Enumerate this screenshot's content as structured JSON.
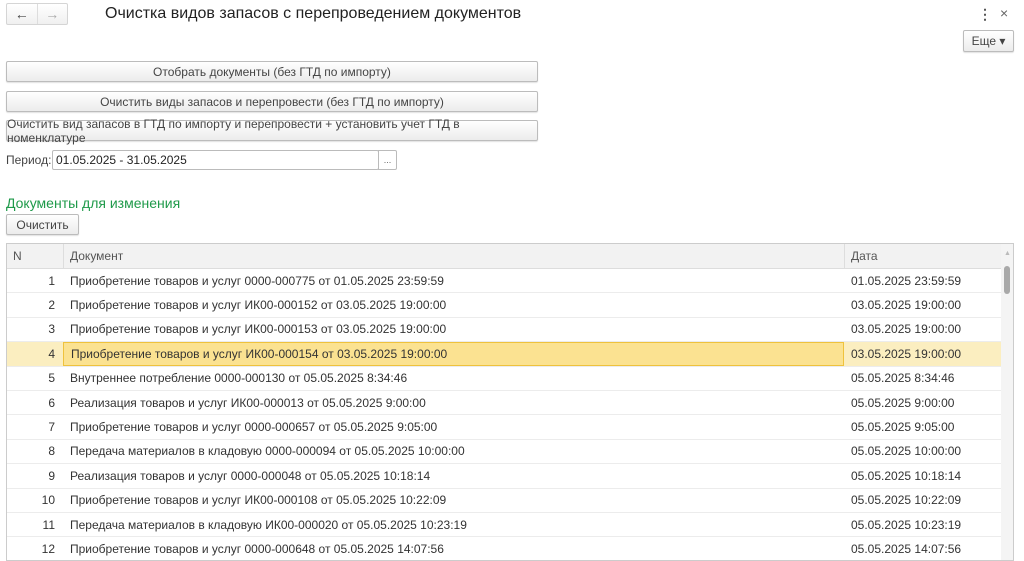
{
  "header": {
    "title": "Очистка видов запасов с перепроведением документов",
    "back": "←",
    "forward": "→",
    "menu": "⋮",
    "close": "×",
    "more_label": "Еще ▾"
  },
  "actions": {
    "select_docs": "Отобрать документы (без ГТД по импорту)",
    "clear_repost": "Очистить виды запасов и перепровести (без ГТД по импорту)",
    "clear_gtd": "Очистить вид запасов в ГТД по импорту и перепровести + установить учет ГТД в номенклатуре"
  },
  "period": {
    "label": "Период:",
    "value": "01.05.2025 - 31.05.2025",
    "select": "..."
  },
  "section": {
    "title": "Документы для изменения",
    "clear_label": "Очистить"
  },
  "table": {
    "columns": [
      "N",
      "Документ",
      "Дата"
    ],
    "selected_row": 4,
    "rows": [
      {
        "n": "1",
        "doc": "Приобретение товаров и услуг 0000-000775 от 01.05.2025 23:59:59",
        "date": "01.05.2025 23:59:59"
      },
      {
        "n": "2",
        "doc": "Приобретение товаров и услуг ИК00-000152 от 03.05.2025 19:00:00",
        "date": "03.05.2025 19:00:00"
      },
      {
        "n": "3",
        "doc": "Приобретение товаров и услуг ИК00-000153 от 03.05.2025 19:00:00",
        "date": "03.05.2025 19:00:00"
      },
      {
        "n": "4",
        "doc": "Приобретение товаров и услуг ИК00-000154 от 03.05.2025 19:00:00",
        "date": "03.05.2025 19:00:00"
      },
      {
        "n": "5",
        "doc": "Внутреннее потребление 0000-000130 от 05.05.2025 8:34:46",
        "date": "05.05.2025 8:34:46"
      },
      {
        "n": "6",
        "doc": "Реализация товаров и услуг ИК00-000013 от 05.05.2025 9:00:00",
        "date": "05.05.2025 9:00:00"
      },
      {
        "n": "7",
        "doc": "Приобретение товаров и услуг 0000-000657 от 05.05.2025 9:05:00",
        "date": "05.05.2025 9:05:00"
      },
      {
        "n": "8",
        "doc": "Передача материалов в кладовую 0000-000094 от 05.05.2025 10:00:00",
        "date": "05.05.2025 10:00:00"
      },
      {
        "n": "9",
        "doc": "Реализация товаров и услуг 0000-000048 от 05.05.2025 10:18:14",
        "date": "05.05.2025 10:18:14"
      },
      {
        "n": "10",
        "doc": "Приобретение товаров и услуг ИК00-000108 от 05.05.2025 10:22:09",
        "date": "05.05.2025 10:22:09"
      },
      {
        "n": "11",
        "doc": "Передача материалов в кладовую ИК00-000020 от 05.05.2025 10:23:19",
        "date": "05.05.2025 10:23:19"
      },
      {
        "n": "12",
        "doc": "Приобретение товаров и услуг 0000-000648 от 05.05.2025 14:07:56",
        "date": "05.05.2025 14:07:56"
      }
    ]
  }
}
